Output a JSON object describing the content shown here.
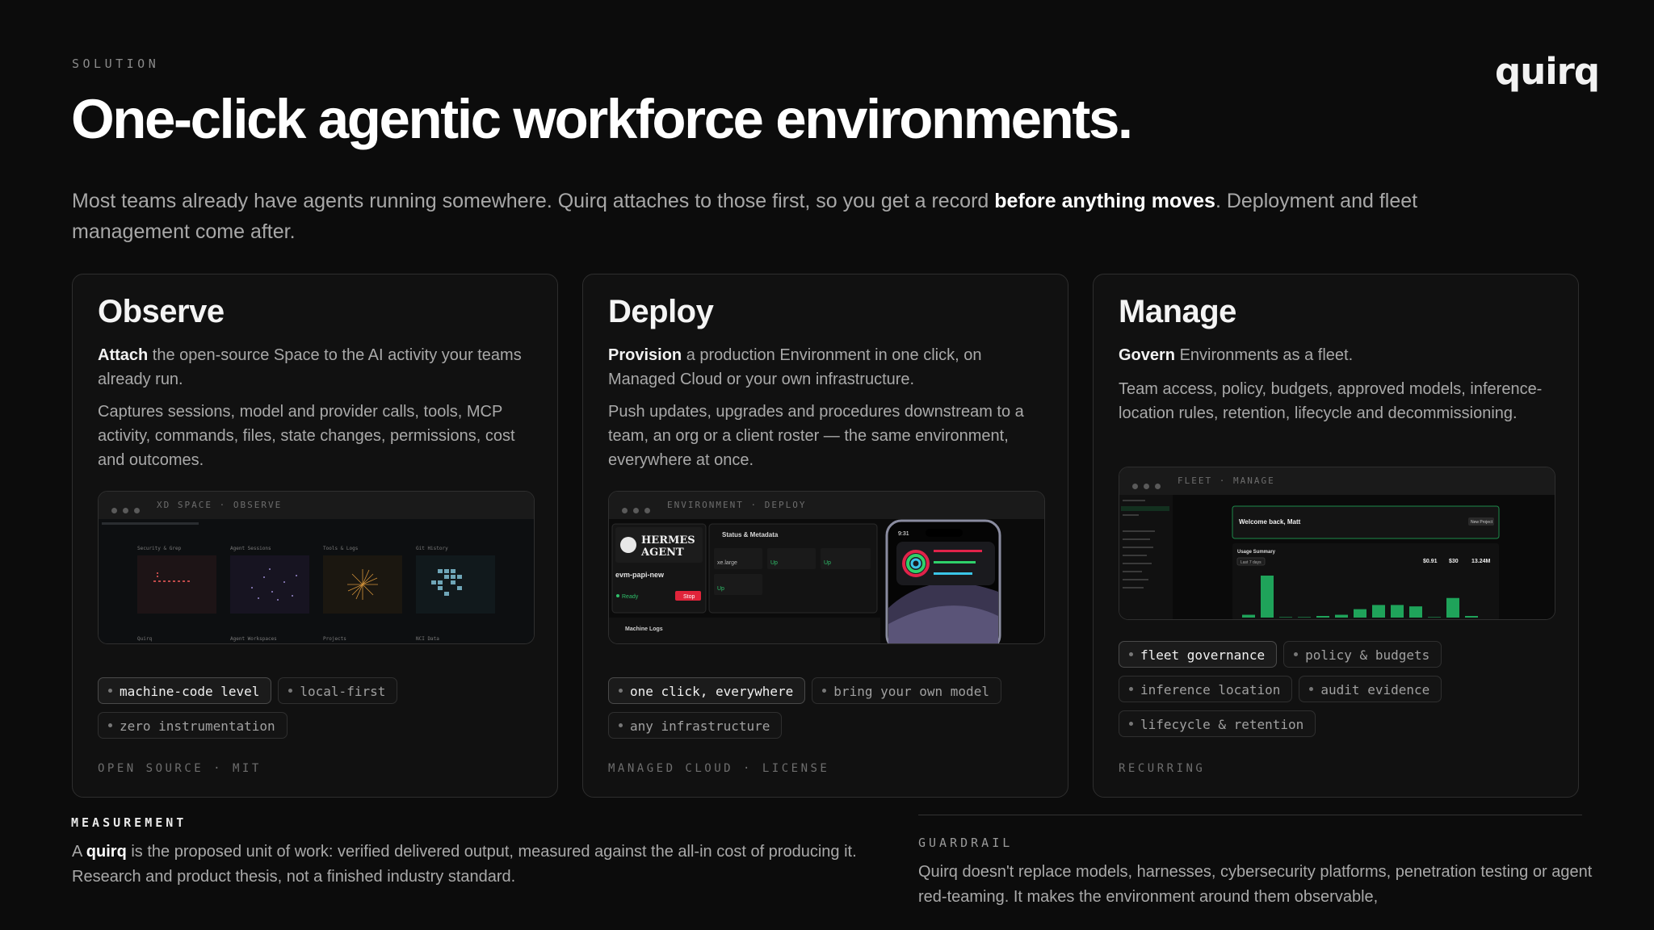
{
  "eyebrow": "SOLUTION",
  "logo": "quirq",
  "title": "One-click agentic workforce environments.",
  "intro": {
    "pre": "Most teams already have agents running somewhere. Quirq attaches to those first, so you get a record ",
    "bold": "before anything moves",
    "post": ". Deployment and fleet management come after."
  },
  "cards": [
    {
      "title": "Observe",
      "lead_bold": "Attach",
      "lead_rest": " the open-source Space to the AI activity your teams already run.",
      "body": "Captures sessions, model and provider calls, tools, MCP activity, commands, files, state changes, permissions, cost and outcomes.",
      "window_title": "XD SPACE · OBSERVE",
      "panels": [
        "Security & Grep",
        "Agent Sessions",
        "Tools & Logs",
        "Git History"
      ],
      "panel_footers": [
        "Quirq",
        "Agent Workspaces",
        "Projects",
        "NCI Data"
      ],
      "tags": [
        "machine-code level",
        "local-first",
        "zero instrumentation"
      ],
      "footer": "OPEN SOURCE · MIT"
    },
    {
      "title": "Deploy",
      "lead_bold": "Provision",
      "lead_rest": " a production Environment in one click, on Managed Cloud or your own infrastructure.",
      "body": "Push updates, upgrades and procedures downstream to a team, an org or a client roster — the same environment, everywhere at once.",
      "window_title": "ENVIRONMENT · DEPLOY",
      "agent_logo_1": "HERMES",
      "agent_logo_2": "AGENT",
      "env_name": "evm-papi-new",
      "env_status": "Ready",
      "stop_label": "Stop",
      "panel_title": "Status & Metadata",
      "machine_logs": "Machine Logs",
      "instance": "xe.large",
      "up": "Up",
      "phone_time": "9:31",
      "tags": [
        "one click, everywhere",
        "bring your own model",
        "any infrastructure"
      ],
      "footer": "MANAGED CLOUD · LICENSE"
    },
    {
      "title": "Manage",
      "lead_bold": "Govern",
      "lead_rest": " Environments as a fleet.",
      "body": "Team access, policy, budgets, approved models, inference-location rules, retention, lifecycle and decommissioning.",
      "window_title": "FLEET · MANAGE",
      "welcome": "Welcome back, Matt",
      "new_project": "New Project",
      "usage_summary": "Usage Summary",
      "period": "Last 7 days",
      "stats": [
        "$0.91",
        "$30",
        "13.24M"
      ],
      "bar_values": [
        2,
        30,
        0,
        0,
        1,
        2,
        6,
        9,
        9,
        8,
        0,
        14,
        1
      ],
      "bar_color": "#1fa35a",
      "tags": [
        "fleet governance",
        "policy & budgets",
        "inference location",
        "audit evidence",
        "lifecycle & retention"
      ],
      "footer": "RECURRING"
    }
  ],
  "measurement": {
    "label": "MEASUREMENT",
    "pre": "A ",
    "bold": "quirq",
    "post": " is the proposed unit of work: verified delivered output, measured against the all-in cost of producing it. Research and product thesis, not a finished industry standard."
  },
  "guardrail": {
    "label": "GUARDRAIL",
    "text": "Quirq doesn't replace models, harnesses, cybersecurity platforms, penetration testing or agent red-teaming. It makes the environment around them observable,"
  }
}
